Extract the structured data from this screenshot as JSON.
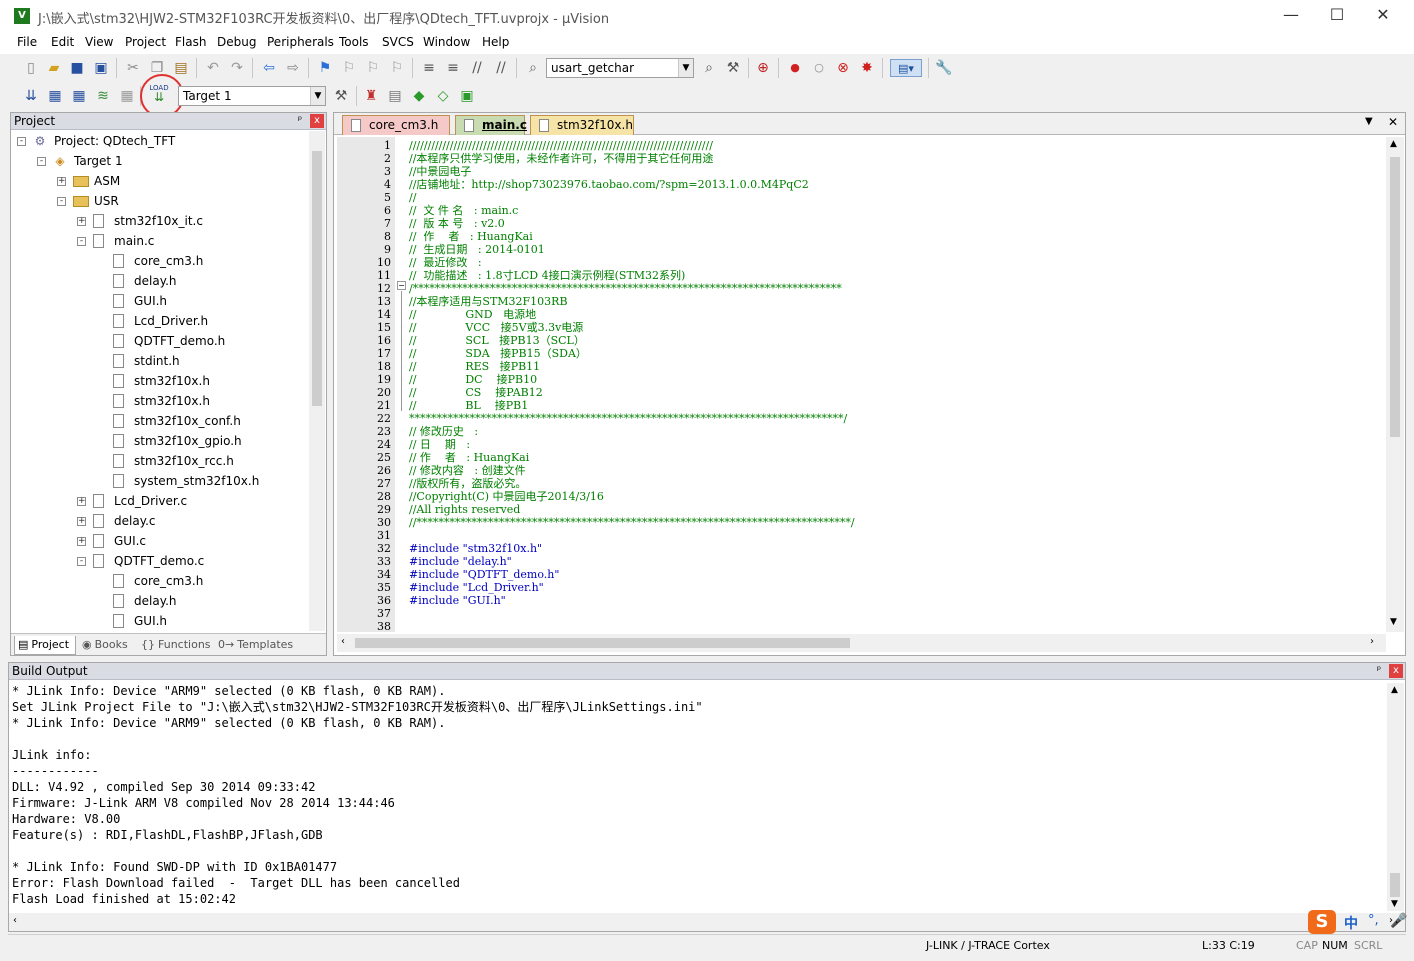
{
  "window": {
    "title": "J:\\嵌入式\\stm32\\HJW2-STM32F103RC开发板资料\\0、出厂程序\\QDtech_TFT.uvprojx - µVision",
    "icon_letter": "V",
    "minimize": "—",
    "maximize": "☐",
    "close": "✕"
  },
  "menu": [
    "File",
    "Edit",
    "View",
    "Project",
    "Flash",
    "Debug",
    "Peripherals",
    "Tools",
    "SVCS",
    "Window",
    "Help"
  ],
  "toolbar1": {
    "find_combo_value": "usart_getchar"
  },
  "toolbar2": {
    "target_combo_value": "Target 1",
    "load_label": "LOAD"
  },
  "project_pane": {
    "title": "Project",
    "pin": "ᵖ",
    "close": "x",
    "tree": [
      {
        "label": "Project: QDtech_TFT",
        "level": 0,
        "toggle": "-",
        "kind": "project"
      },
      {
        "label": "Target 1",
        "level": 1,
        "toggle": "-",
        "kind": "target"
      },
      {
        "label": "ASM",
        "level": 2,
        "toggle": "+",
        "kind": "folder"
      },
      {
        "label": "USR",
        "level": 2,
        "toggle": "-",
        "kind": "folder"
      },
      {
        "label": "stm32f10x_it.c",
        "level": 3,
        "toggle": "+",
        "kind": "file"
      },
      {
        "label": "main.c",
        "level": 3,
        "toggle": "-",
        "kind": "file"
      },
      {
        "label": "core_cm3.h",
        "level": 4,
        "toggle": "",
        "kind": "file"
      },
      {
        "label": "delay.h",
        "level": 4,
        "toggle": "",
        "kind": "file"
      },
      {
        "label": "GUI.h",
        "level": 4,
        "toggle": "",
        "kind": "file"
      },
      {
        "label": "Lcd_Driver.h",
        "level": 4,
        "toggle": "",
        "kind": "file"
      },
      {
        "label": "QDTFT_demo.h",
        "level": 4,
        "toggle": "",
        "kind": "file"
      },
      {
        "label": "stdint.h",
        "level": 4,
        "toggle": "",
        "kind": "file"
      },
      {
        "label": "stm32f10x.h",
        "level": 4,
        "toggle": "",
        "kind": "file"
      },
      {
        "label": "stm32f10x.h",
        "level": 4,
        "toggle": "",
        "kind": "file"
      },
      {
        "label": "stm32f10x_conf.h",
        "level": 4,
        "toggle": "",
        "kind": "file"
      },
      {
        "label": "stm32f10x_gpio.h",
        "level": 4,
        "toggle": "",
        "kind": "file"
      },
      {
        "label": "stm32f10x_rcc.h",
        "level": 4,
        "toggle": "",
        "kind": "file"
      },
      {
        "label": "system_stm32f10x.h",
        "level": 4,
        "toggle": "",
        "kind": "file"
      },
      {
        "label": "Lcd_Driver.c",
        "level": 3,
        "toggle": "+",
        "kind": "file"
      },
      {
        "label": "delay.c",
        "level": 3,
        "toggle": "+",
        "kind": "file"
      },
      {
        "label": "GUI.c",
        "level": 3,
        "toggle": "+",
        "kind": "file"
      },
      {
        "label": "QDTFT_demo.c",
        "level": 3,
        "toggle": "-",
        "kind": "file"
      },
      {
        "label": "core_cm3.h",
        "level": 4,
        "toggle": "",
        "kind": "file"
      },
      {
        "label": "delay.h",
        "level": 4,
        "toggle": "",
        "kind": "file"
      },
      {
        "label": "GUI.h",
        "level": 4,
        "toggle": "",
        "kind": "file"
      }
    ],
    "tabs": [
      {
        "label": "Project",
        "icon": "▤",
        "active": true
      },
      {
        "label": "Books",
        "icon": "◉",
        "active": false
      },
      {
        "label": "Functions",
        "icon": "{}",
        "active": false
      },
      {
        "label": "Templates",
        "icon": "0→",
        "active": false
      }
    ]
  },
  "editor": {
    "tabs": [
      {
        "label": "core_cm3.h",
        "active": false,
        "color": "#f6c9c9"
      },
      {
        "label": "main.c",
        "active": true,
        "color": "#c9dbb1"
      },
      {
        "label": "stm32f10x.h",
        "active": false,
        "color": "#f6e3a6"
      }
    ],
    "lines": [
      {
        "n": "1",
        "text": "//////////////////////////////////////////////////////////////////////////////////",
        "cls": "cmt"
      },
      {
        "n": "2",
        "text": "//本程序只供学习使用，未经作者许可，不得用于其它任何用途",
        "cls": "cmt"
      },
      {
        "n": "3",
        "text": "//中景园电子",
        "cls": "cmt"
      },
      {
        "n": "4",
        "text": "//店铺地址：http://shop73023976.taobao.com/?spm=2013.1.0.0.M4PqC2",
        "cls": "cmt"
      },
      {
        "n": "5",
        "text": "//",
        "cls": "cmt"
      },
      {
        "n": "6",
        "text": "//  文 件 名   : main.c",
        "cls": "cmt"
      },
      {
        "n": "7",
        "text": "//  版 本 号   : v2.0",
        "cls": "cmt"
      },
      {
        "n": "8",
        "text": "//  作    者   : HuangKai",
        "cls": "cmt"
      },
      {
        "n": "9",
        "text": "//  生成日期   : 2014-0101",
        "cls": "cmt"
      },
      {
        "n": "10",
        "text": "//  最近修改   :",
        "cls": "cmt"
      },
      {
        "n": "11",
        "text": "//  功能描述   : 1.8寸LCD 4接口演示例程(STM32系列)",
        "cls": "cmt"
      },
      {
        "n": "12",
        "text": "/******************************************************************************",
        "cls": "cmt"
      },
      {
        "n": "13",
        "text": "//本程序适用与STM32F103RB",
        "cls": "cmt"
      },
      {
        "n": "14",
        "text": "//              GND   电源地",
        "cls": "cmt"
      },
      {
        "n": "15",
        "text": "//              VCC   接5V或3.3v电源",
        "cls": "cmt"
      },
      {
        "n": "16",
        "text": "//              SCL   接PB13（SCL）",
        "cls": "cmt"
      },
      {
        "n": "17",
        "text": "//              SDA   接PB15（SDA）",
        "cls": "cmt"
      },
      {
        "n": "18",
        "text": "//              RES   接PB11",
        "cls": "cmt"
      },
      {
        "n": "19",
        "text": "//              DC    接PB10",
        "cls": "cmt"
      },
      {
        "n": "20",
        "text": "//              CS    接PAB12",
        "cls": "cmt"
      },
      {
        "n": "21",
        "text": "//              BL    接PB1",
        "cls": "cmt"
      },
      {
        "n": "22",
        "text": "*******************************************************************************/",
        "cls": "cmt"
      },
      {
        "n": "23",
        "text": "// 修改历史   :",
        "cls": "cmt"
      },
      {
        "n": "24",
        "text": "// 日    期   :",
        "cls": "cmt"
      },
      {
        "n": "25",
        "text": "// 作    者   : HuangKai",
        "cls": "cmt"
      },
      {
        "n": "26",
        "text": "// 修改内容   : 创建文件",
        "cls": "cmt"
      },
      {
        "n": "27",
        "text": "//版权所有，盗版必究。",
        "cls": "cmt"
      },
      {
        "n": "28",
        "text": "//Copyright(C) 中景园电子2014/3/16",
        "cls": "cmt"
      },
      {
        "n": "29",
        "text": "//All rights reserved",
        "cls": "cmt"
      },
      {
        "n": "30",
        "text": "//*******************************************************************************/",
        "cls": "cmt"
      },
      {
        "n": "31",
        "text": "",
        "cls": ""
      },
      {
        "n": "32",
        "text": "#include \"stm32f10x.h\"",
        "cls": "pp"
      },
      {
        "n": "33",
        "text": "#include \"delay.h\"",
        "cls": "pp"
      },
      {
        "n": "34",
        "text": "#include \"QDTFT_demo.h\"",
        "cls": "pp"
      },
      {
        "n": "35",
        "text": "#include \"Lcd_Driver.h\"",
        "cls": "pp"
      },
      {
        "n": "36",
        "text": "#include \"GUI.h\"",
        "cls": "pp"
      },
      {
        "n": "37",
        "text": "",
        "cls": ""
      },
      {
        "n": "38",
        "text": "",
        "cls": ""
      }
    ]
  },
  "build_output": {
    "title": "Build Output",
    "lines": [
      "* JLink Info: Device \"ARM9\" selected (0 KB flash, 0 KB RAM).",
      "Set JLink Project File to \"J:\\嵌入式\\stm32\\HJW2-STM32F103RC开发板资料\\0、出厂程序\\JLinkSettings.ini\"",
      "* JLink Info: Device \"ARM9\" selected (0 KB flash, 0 KB RAM).",
      "",
      "JLink info:",
      "------------",
      "DLL: V4.92 , compiled Sep 30 2014 09:33:42",
      "Firmware: J-Link ARM V8 compiled Nov 28 2014 13:44:46",
      "Hardware: V8.00",
      "Feature(s) : RDI,FlashDL,FlashBP,JFlash,GDB",
      "",
      "* JLink Info: Found SWD-DP with ID 0x1BA01477",
      "Error: Flash Download failed  -  Target DLL has been cancelled",
      "Flash Load finished at 15:02:42"
    ]
  },
  "statusbar": {
    "debugger": "J-LINK / J-TRACE Cortex",
    "position": "L:33 C:19",
    "cap": "CAP",
    "num": "NUM",
    "scrl": "SCRL"
  },
  "ime": {
    "logo": "S",
    "lang": "中",
    "punct": "°,"
  },
  "colors": {
    "highlight_circle": "#e03030",
    "comment": "#008000",
    "preprocessor": "#0000c0"
  }
}
